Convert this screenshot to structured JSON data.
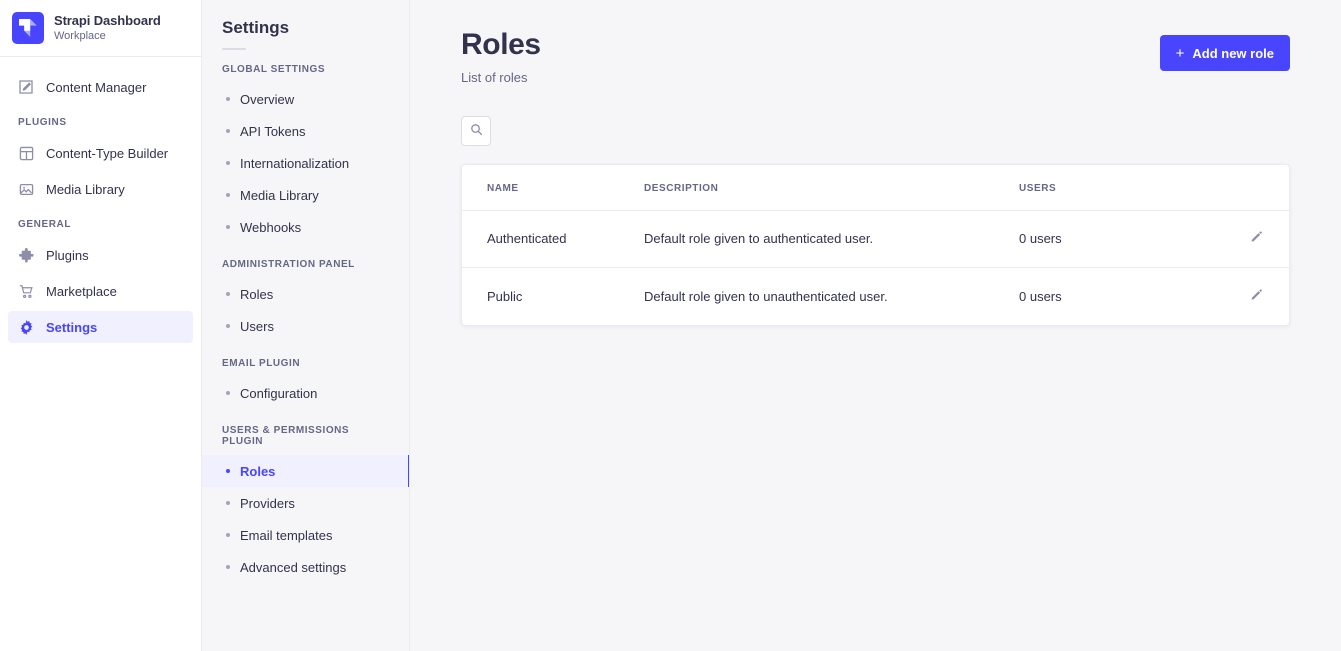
{
  "brand": {
    "title": "Strapi Dashboard",
    "subtitle": "Workplace",
    "logo_icon": "strapi-cube-icon",
    "logo_color": "#4945ff"
  },
  "mainnav": {
    "items": [
      {
        "label": "Content Manager",
        "icon": "pencil-square-icon",
        "active": false
      }
    ],
    "sections": [
      {
        "label": "PLUGINS",
        "items": [
          {
            "label": "Content-Type Builder",
            "icon": "layout-grid-icon",
            "active": false
          },
          {
            "label": "Media Library",
            "icon": "image-icon",
            "active": false
          }
        ]
      },
      {
        "label": "GENERAL",
        "items": [
          {
            "label": "Plugins",
            "icon": "puzzle-icon",
            "active": false
          },
          {
            "label": "Marketplace",
            "icon": "shopping-cart-icon",
            "active": false
          },
          {
            "label": "Settings",
            "icon": "gear-icon",
            "active": true
          }
        ]
      }
    ]
  },
  "subnav": {
    "title": "Settings",
    "sections": [
      {
        "label": "GLOBAL SETTINGS",
        "items": [
          {
            "label": "Overview",
            "active": false
          },
          {
            "label": "API Tokens",
            "active": false
          },
          {
            "label": "Internationalization",
            "active": false
          },
          {
            "label": "Media Library",
            "active": false
          },
          {
            "label": "Webhooks",
            "active": false
          }
        ]
      },
      {
        "label": "ADMINISTRATION PANEL",
        "items": [
          {
            "label": "Roles",
            "active": false
          },
          {
            "label": "Users",
            "active": false
          }
        ]
      },
      {
        "label": "EMAIL PLUGIN",
        "items": [
          {
            "label": "Configuration",
            "active": false
          }
        ]
      },
      {
        "label": "USERS & PERMISSIONS PLUGIN",
        "items": [
          {
            "label": "Roles",
            "active": true
          },
          {
            "label": "Providers",
            "active": false
          },
          {
            "label": "Email templates",
            "active": false
          },
          {
            "label": "Advanced settings",
            "active": false
          }
        ]
      }
    ]
  },
  "page": {
    "title": "Roles",
    "subtitle": "List of roles",
    "add_button_label": "Add new role",
    "add_button_icon": "plus-icon",
    "accent_color": "#4945ff"
  },
  "toolbar": {
    "search_icon": "search-icon"
  },
  "table": {
    "columns": [
      "NAME",
      "DESCRIPTION",
      "USERS",
      ""
    ],
    "rows": [
      {
        "name": "Authenticated",
        "description": "Default role given to authenticated user.",
        "users": "0 users",
        "action_icon": "pencil-icon"
      },
      {
        "name": "Public",
        "description": "Default role given to unauthenticated user.",
        "users": "0 users",
        "action_icon": "pencil-icon"
      }
    ]
  }
}
